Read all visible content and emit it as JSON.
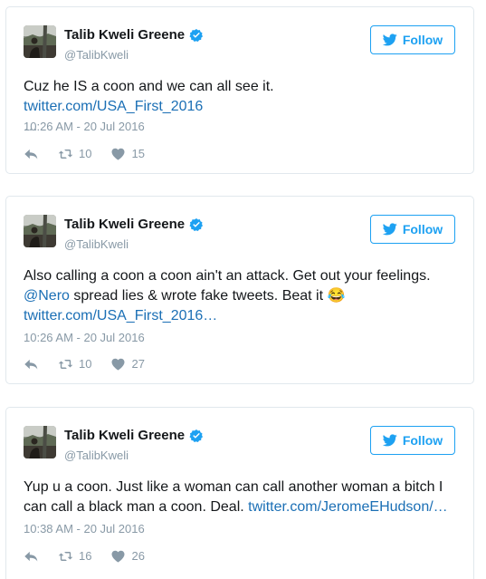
{
  "tweets": [
    {
      "name": "Talib Kweli Greene",
      "handle": "@TalibKweli",
      "follow_label": "Follow",
      "text_plain": "Cuz he IS a coon and we can all see it. ",
      "link": "twitter.com/USA_First_2016",
      "ellipsis": "…",
      "time": "10:26 AM - 20 Jul 2016",
      "retweets": "10",
      "likes": "15"
    },
    {
      "name": "Talib Kweli Greene",
      "handle": "@TalibKweli",
      "follow_label": "Follow",
      "line1": "Also calling a coon a coon ain't an attack. Get out your feelings.",
      "mention": "@Nero",
      "line2_rest": " spread lies & wrote fake tweets. Beat it ",
      "emoji": "😂",
      "link": "twitter.com/USA_First_2016…",
      "time": "10:26 AM - 20 Jul 2016",
      "retweets": "10",
      "likes": "27"
    },
    {
      "name": "Talib Kweli Greene",
      "handle": "@TalibKweli",
      "follow_label": "Follow",
      "line1": "Yup u a coon. Just like a woman can call another woman a bitch I",
      "line2_plain": "can call a black man a coon. Deal. ",
      "link": "twitter.com/JeromeEHudson/…",
      "time": "10:38 AM - 20 Jul 2016",
      "retweets": "16",
      "likes": "26"
    }
  ],
  "icons": {
    "verified": "verified-badge-icon",
    "bird": "twitter-bird-icon",
    "reply": "reply-icon",
    "retweet": "retweet-icon",
    "like": "heart-icon"
  },
  "colors": {
    "accent": "#1da1f2",
    "link": "#1b6fb5",
    "muted": "#8899a6",
    "border": "#e1e8ed"
  }
}
